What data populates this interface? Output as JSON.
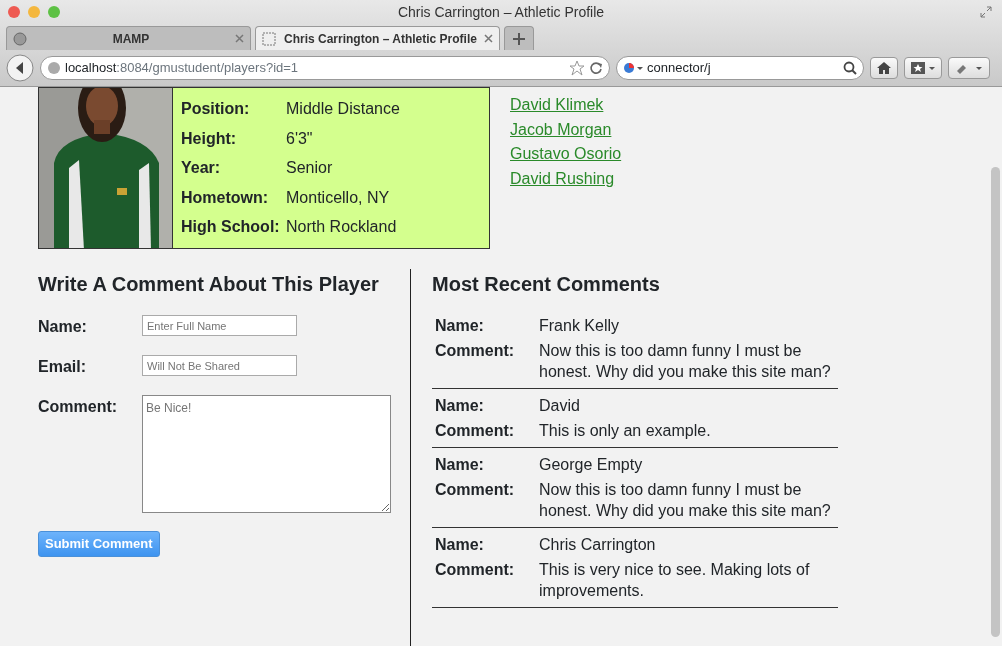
{
  "window": {
    "title": "Chris Carrington – Athletic Profile"
  },
  "tabs": [
    {
      "label": "MAMP",
      "selected": false
    },
    {
      "label": "Chris Carrington – Athletic Profile",
      "selected": true
    }
  ],
  "address_bar": {
    "host": "localhost",
    "path": ":8084/gmustudent/players?id=1"
  },
  "search": {
    "value": "connector/j"
  },
  "profile": {
    "fields": [
      {
        "label": "Position:",
        "value": "Middle Distance"
      },
      {
        "label": "Height:",
        "value": "6'3\""
      },
      {
        "label": "Year:",
        "value": "Senior"
      },
      {
        "label": "Hometown:",
        "value": "Monticello, NY"
      },
      {
        "label": "High School:",
        "value": "North Rockland"
      }
    ]
  },
  "player_links": [
    "David Klimek",
    "Jacob Morgan",
    "Gustavo Osorio",
    "David Rushing"
  ],
  "comment_form": {
    "title": "Write A Comment About This Player",
    "name_label": "Name:",
    "name_placeholder": "Enter Full Name",
    "email_label": "Email:",
    "email_placeholder": "Will Not Be Shared",
    "comment_label": "Comment:",
    "comment_placeholder": "Be Nice!",
    "submit": "Submit Comment"
  },
  "recent_comments": {
    "title": "Most Recent Comments",
    "items": [
      {
        "name_label": "Name:",
        "name": "Frank Kelly",
        "comment_label": "Comment:",
        "comment": "Now this is too damn funny I must be honest. Why did you make this site man?"
      },
      {
        "name_label": "Name:",
        "name": "David",
        "comment_label": "Comment:",
        "comment": "This is only an example."
      },
      {
        "name_label": "Name:",
        "name": "George Empty",
        "comment_label": "Comment:",
        "comment": "Now this is too damn funny I must be honest. Why did you make this site man?"
      },
      {
        "name_label": "Name:",
        "name": "Chris Carrington",
        "comment_label": "Comment:",
        "comment": "This is very nice to see. Making lots of improvements."
      }
    ]
  }
}
